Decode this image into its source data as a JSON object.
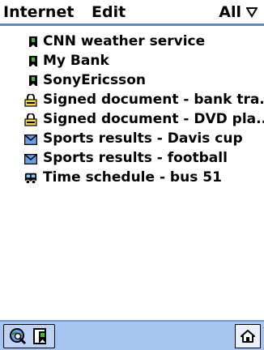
{
  "menu": {
    "internet": "Internet",
    "edit": "Edit",
    "filter": "All"
  },
  "items": [
    {
      "label": "CNN weather service",
      "icon": "bookmark-icon"
    },
    {
      "label": "My Bank",
      "icon": "bookmark-icon"
    },
    {
      "label": "SonyEricsson",
      "icon": "bookmark-icon"
    },
    {
      "label": "Signed document - bank tra...",
      "icon": "signed-document-icon"
    },
    {
      "label": "Signed document - DVD pla...",
      "icon": "signed-document-icon"
    },
    {
      "label": "Sports results - Davis cup",
      "icon": "envelope-icon"
    },
    {
      "label": "Sports results - football",
      "icon": "envelope-icon"
    },
    {
      "label": "Time schedule - bus 51",
      "icon": "bus-icon"
    }
  ],
  "colors": {
    "header_rule": "#6a86b8",
    "footer_bg": "#a6c4f0"
  },
  "footer": {
    "left_icons": [
      "globe-search-icon",
      "bookmark-page-icon"
    ],
    "right_icon": "home-icon"
  }
}
